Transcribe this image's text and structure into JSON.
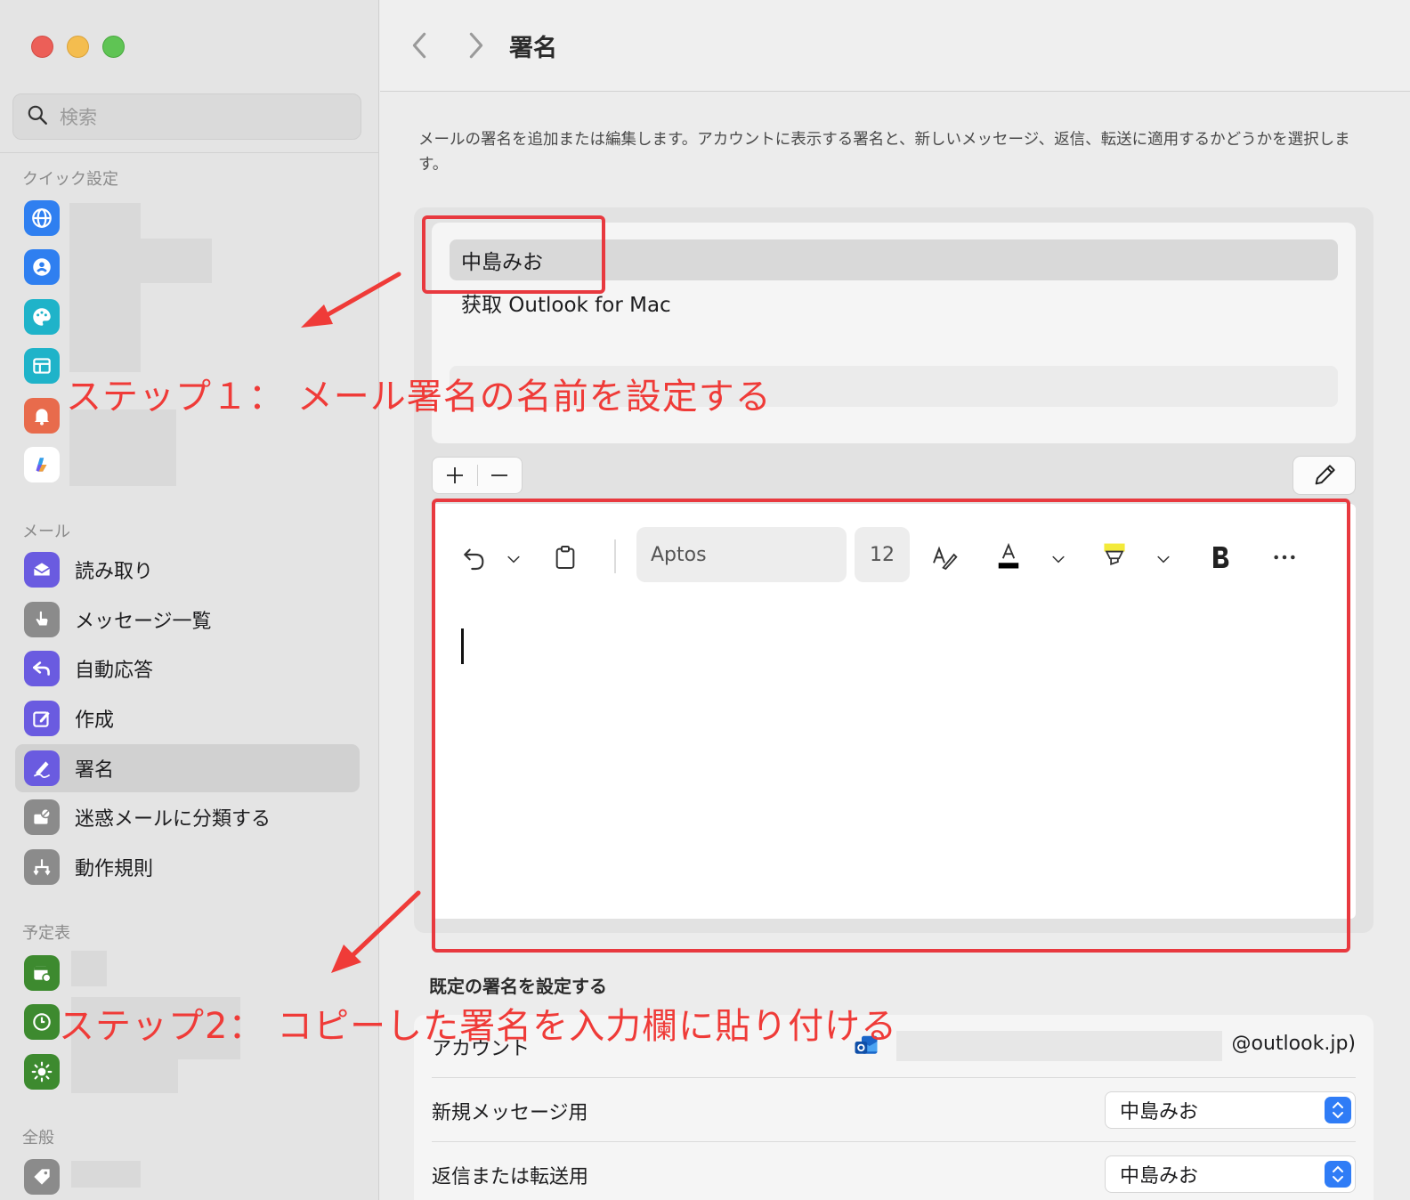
{
  "sidebar": {
    "search_placeholder": "検索",
    "sections": {
      "quick": "クイック設定",
      "mail": "メール",
      "calendar": "予定表",
      "general": "全般"
    },
    "mail_items": [
      {
        "label": "読み取り",
        "icon": "envelope-open-icon"
      },
      {
        "label": "メッセージ一覧",
        "icon": "hand-pointer-icon"
      },
      {
        "label": "自動応答",
        "icon": "reply-arrow-icon"
      },
      {
        "label": "作成",
        "icon": "compose-icon"
      },
      {
        "label": "署名",
        "icon": "signature-pen-icon",
        "selected": true
      },
      {
        "label": "迷惑メールに分類する",
        "icon": "junk-mail-icon"
      },
      {
        "label": "動作規則",
        "icon": "rules-icon"
      }
    ],
    "quick_icons": [
      "globe-icon",
      "person-circle-icon",
      "palette-icon",
      "layout-icon",
      "bell-icon",
      "copilot-icon"
    ],
    "calendar_icons": [
      "calendar-gear-icon",
      "clock-icon",
      "sun-icon"
    ],
    "general_icons": [
      "tag-icon"
    ]
  },
  "header": {
    "title": "署名"
  },
  "main": {
    "description": "メールの署名を追加または編集します。アカウントに表示する署名と、新しいメッセージ、返信、転送に適用するかどうかを選択します。",
    "signatures": [
      "中島みお",
      "获取 Outlook for Mac",
      ""
    ],
    "editor": {
      "font": "Aptos",
      "size": "12"
    },
    "default_section": {
      "title": "既定の署名を設定する",
      "account_label": "アカウント",
      "account_email": "@outlook.jp)",
      "new_message_label": "新規メッセージ用",
      "new_message_value": "中島みお",
      "reply_label": "返信または転送用",
      "reply_value": "中島みお"
    }
  },
  "annotations": {
    "step1": "ステップ１：  メール署名の名前を設定する",
    "step2": "ステップ2：  コピーした署名を入力欄に貼り付ける",
    "color": "#ef3b38"
  }
}
